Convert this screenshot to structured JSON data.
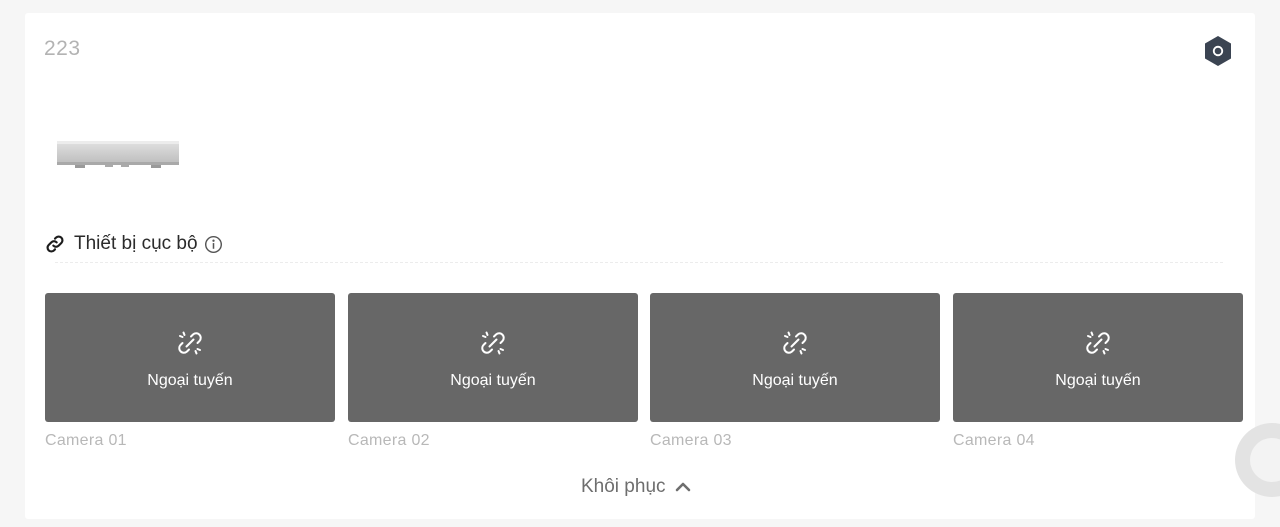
{
  "device": {
    "name": "223",
    "image_icon": "nvr-box-icon",
    "settings_icon": "gear-icon"
  },
  "local": {
    "title": "Thiết bị cục bộ",
    "link_icon": "link-icon",
    "info_icon": "info-icon"
  },
  "cameras": [
    {
      "status": "Ngoại tuyến",
      "label": "Camera 01",
      "icon": "unlink-icon"
    },
    {
      "status": "Ngoại tuyến",
      "label": "Camera 02",
      "icon": "unlink-icon"
    },
    {
      "status": "Ngoại tuyến",
      "label": "Camera 03",
      "icon": "unlink-icon"
    },
    {
      "status": "Ngoại tuyến",
      "label": "Camera 04",
      "icon": "unlink-icon"
    }
  ],
  "collapse": {
    "label": "Khôi phục",
    "icon": "chevron-up-icon"
  },
  "colors": {
    "tile_bg": "#676767",
    "settings": "#3b4452"
  }
}
